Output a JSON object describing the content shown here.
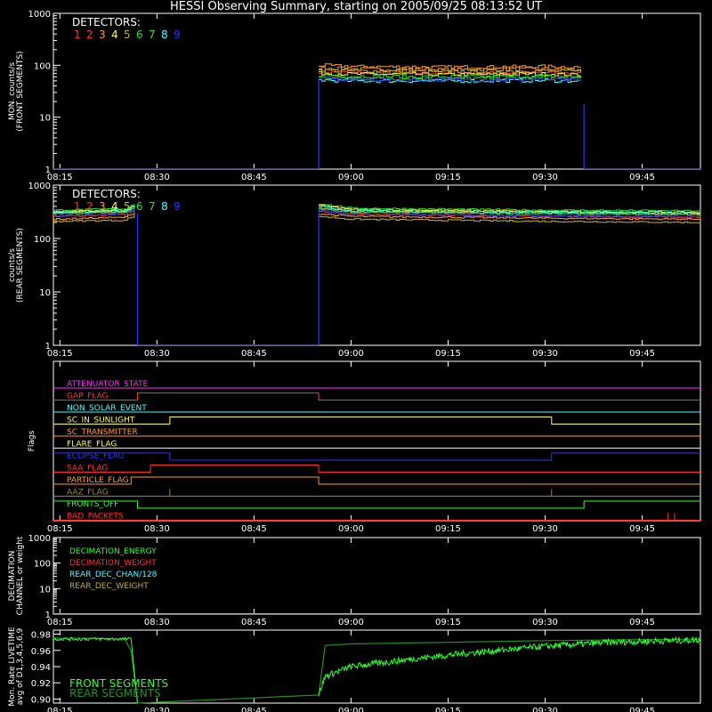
{
  "title": "HESSI Observing Summary, starting on 2005/09/25 08:13:52 UT",
  "time_axis": {
    "start": "08:14",
    "end": "09:54",
    "ticks": [
      "08:15",
      "08:30",
      "08:45",
      "09:00",
      "09:15",
      "09:30",
      "09:45"
    ]
  },
  "colors": {
    "white": "#ffffff",
    "red": "#ff3030",
    "orange": "#ff9a2a",
    "yellow": "#ffff40",
    "green": "#30e030",
    "cyan": "#40ffff",
    "blue": "#3030ff",
    "magenta": "#ff30ff",
    "olive": "#c0b030",
    "lime": "#30ff30",
    "brown": "#a08820"
  },
  "panels": {
    "front": {
      "ylabel": [
        "MON. counts/s",
        "(FRONT SEGMENTS)"
      ],
      "yticks": [
        "1",
        "10",
        "100",
        "1000"
      ],
      "legend_title": "DETECTORS:",
      "detectors": [
        "1",
        "2",
        "3",
        "4",
        "5",
        "6",
        "7",
        "8",
        "9"
      ]
    },
    "rear": {
      "ylabel": [
        "counts/s",
        "(REAR SEGMENTS)"
      ],
      "yticks": [
        "1",
        "10",
        "100",
        "1000"
      ],
      "legend_title": "DETECTORS:",
      "detectors": [
        "1",
        "2",
        "3",
        "4",
        "5",
        "6",
        "7",
        "8",
        "9"
      ]
    },
    "flags": {
      "ylabel": [
        "Flags"
      ],
      "labels": [
        "ATTENUATOR_STATE",
        "GAP_FLAG",
        "NON_SOLAR_EVENT",
        "SC_IN_SUNLIGHT",
        "SC_TRANSMITTER",
        "FLARE_FLAG",
        "ECLIPSE_FLAG",
        "SAA_FLAG",
        "PARTICLE_FLAG",
        "AAZ_FLAG",
        "FRONTS_OFF",
        "BAD_PACKETS"
      ]
    },
    "decimation": {
      "ylabel": [
        "DECIMATION",
        "CHANNEL or weight"
      ],
      "yticks": [
        "1",
        "10",
        "100",
        "1000"
      ],
      "labels": [
        "DECIMATION_ENERGY",
        "DECIMATION_WEIGHT",
        "REAR_DEC_CHAN/128",
        "REAR_DEC_WEIGHT"
      ]
    },
    "livetime": {
      "ylabel": [
        "Mon. Rate LIVETIME",
        "avg of D1,3,4,5,6,9"
      ],
      "yticks": [
        "0.90",
        "0.92",
        "0.94",
        "0.96",
        "0.98"
      ],
      "labels": [
        "FRONT SEGMENTS",
        "REAR SEGMENTS"
      ]
    }
  },
  "chart_data": [
    {
      "type": "line",
      "title": "HESSI Observing Summary, starting on 2005/09/25 08:13:52 UT",
      "ylabel": "MON. counts/s (FRONT SEGMENTS)",
      "yscale": "log",
      "ylim": [
        1,
        1000
      ],
      "gaps": [
        [
          "08:14",
          "08:55"
        ],
        [
          "09:36",
          "09:54"
        ]
      ],
      "series": [
        {
          "name": "1",
          "color": "#ff3030",
          "x": [
            "08:55",
            "09:00",
            "09:15",
            "09:30",
            "09:35"
          ],
          "y": [
            75,
            72,
            70,
            72,
            70
          ]
        },
        {
          "name": "2",
          "color": "#ff9a2a",
          "x": [
            "08:55",
            "09:00",
            "09:15",
            "09:30",
            "09:35"
          ],
          "y": [
            90,
            85,
            82,
            85,
            80
          ]
        },
        {
          "name": "3",
          "color": "#ff9a2a",
          "x": [
            "08:55",
            "09:00",
            "09:15",
            "09:30",
            "09:35"
          ],
          "y": [
            100,
            95,
            92,
            95,
            92
          ]
        },
        {
          "name": "4",
          "color": "#ffff40",
          "x": [
            "08:55",
            "09:00",
            "09:15",
            "09:30",
            "09:35"
          ],
          "y": [
            70,
            68,
            66,
            68,
            66
          ]
        },
        {
          "name": "5",
          "color": "#c0b030",
          "x": [
            "08:55",
            "09:00",
            "09:15",
            "09:30",
            "09:35"
          ],
          "y": [
            80,
            78,
            76,
            78,
            76
          ]
        },
        {
          "name": "6",
          "color": "#30e030",
          "x": [
            "08:55",
            "09:00",
            "09:15",
            "09:30",
            "09:35"
          ],
          "y": [
            65,
            62,
            60,
            62,
            60
          ]
        },
        {
          "name": "7",
          "color": "#30e030",
          "x": [
            "08:55",
            "09:00",
            "09:15",
            "09:30",
            "09:35"
          ],
          "y": [
            58,
            56,
            55,
            57,
            55
          ]
        },
        {
          "name": "8",
          "color": "#40ffff",
          "x": [
            "08:55",
            "09:00",
            "09:15",
            "09:30",
            "09:35"
          ],
          "y": [
            52,
            50,
            50,
            51,
            50
          ]
        },
        {
          "name": "9",
          "color": "#3030ff",
          "x": [
            "08:55",
            "09:00",
            "09:15",
            "09:30",
            "09:35"
          ],
          "y": [
            55,
            53,
            52,
            54,
            52
          ]
        }
      ]
    },
    {
      "type": "line",
      "ylabel": "counts/s (REAR SEGMENTS)",
      "yscale": "log",
      "ylim": [
        1,
        1000
      ],
      "gaps": [
        [
          "08:27",
          "08:55"
        ]
      ],
      "series": [
        {
          "name": "1",
          "color": "#ff3030",
          "x": [
            "08:14",
            "08:25",
            "08:27",
            "08:55",
            "09:00",
            "09:30",
            "09:54"
          ],
          "y": [
            260,
            280,
            380,
            330,
            290,
            260,
            250
          ]
        },
        {
          "name": "2",
          "color": "#ff9a2a",
          "x": [
            "08:14",
            "08:25",
            "08:27",
            "08:55",
            "09:00",
            "09:30",
            "09:54"
          ],
          "y": [
            300,
            320,
            420,
            380,
            320,
            300,
            290
          ]
        },
        {
          "name": "3",
          "color": "#ff9a2a",
          "x": [
            "08:14",
            "08:25",
            "08:27",
            "08:55",
            "09:00",
            "09:30",
            "09:54"
          ],
          "y": [
            230,
            250,
            340,
            290,
            260,
            240,
            230
          ]
        },
        {
          "name": "4",
          "color": "#ffff40",
          "x": [
            "08:14",
            "08:25",
            "08:27",
            "08:55",
            "09:00",
            "09:30",
            "09:54"
          ],
          "y": [
            320,
            340,
            460,
            420,
            350,
            320,
            310
          ]
        },
        {
          "name": "5",
          "color": "#c0b030",
          "x": [
            "08:14",
            "08:25",
            "08:27",
            "08:55",
            "09:00",
            "09:30",
            "09:54"
          ],
          "y": [
            210,
            220,
            300,
            260,
            230,
            210,
            200
          ]
        },
        {
          "name": "6",
          "color": "#30e030",
          "x": [
            "08:14",
            "08:25",
            "08:27",
            "08:55",
            "09:00",
            "09:30",
            "09:54"
          ],
          "y": [
            340,
            360,
            480,
            450,
            370,
            340,
            330
          ]
        },
        {
          "name": "7",
          "color": "#30e030",
          "x": [
            "08:14",
            "08:25",
            "08:27",
            "08:55",
            "09:00",
            "09:30",
            "09:54"
          ],
          "y": [
            290,
            310,
            400,
            360,
            310,
            290,
            280
          ]
        },
        {
          "name": "8",
          "color": "#40ffff",
          "x": [
            "08:14",
            "08:25",
            "08:27",
            "08:55",
            "09:00",
            "09:30",
            "09:54"
          ],
          "y": [
            310,
            330,
            440,
            400,
            330,
            310,
            300
          ]
        },
        {
          "name": "9",
          "color": "#3030ff",
          "x": [
            "08:14",
            "08:25",
            "08:27",
            "08:55",
            "09:00",
            "09:30",
            "09:54"
          ],
          "y": [
            270,
            290,
            390,
            340,
            280,
            270,
            260
          ]
        }
      ]
    },
    {
      "type": "line",
      "ylabel": "Flags",
      "series": [
        {
          "name": "ATTENUATOR_STATE",
          "color": "#ff30ff",
          "segments": [
            [
              "08:14",
              "09:54",
              0
            ]
          ]
        },
        {
          "name": "GAP_FLAG",
          "color": "#ff3030",
          "segments": [
            [
              "08:14",
              "08:27",
              0
            ],
            [
              "08:27",
              "08:55",
              1
            ],
            [
              "08:55",
              "09:54",
              0
            ]
          ]
        },
        {
          "name": "NON_SOLAR_EVENT",
          "color": "#40ffff",
          "segments": [
            [
              "08:14",
              "09:54",
              0
            ]
          ]
        },
        {
          "name": "SC_IN_SUNLIGHT",
          "color": "#ffff40",
          "segments": [
            [
              "08:14",
              "08:32",
              0
            ],
            [
              "08:32",
              "09:31",
              1
            ],
            [
              "09:31",
              "09:54",
              0
            ]
          ]
        },
        {
          "name": "SC_TRANSMITTER",
          "color": "#ff9a2a",
          "segments": [
            [
              "08:14",
              "09:54",
              0
            ]
          ]
        },
        {
          "name": "FLARE_FLAG",
          "color": "#ffff40",
          "segments": [
            [
              "08:14",
              "09:54",
              0
            ]
          ]
        },
        {
          "name": "ECLIPSE_FLAG",
          "color": "#3030ff",
          "segments": [
            [
              "08:14",
              "08:32",
              1
            ],
            [
              "08:32",
              "09:31",
              0
            ],
            [
              "09:31",
              "09:54",
              1
            ]
          ]
        },
        {
          "name": "SAA_FLAG",
          "color": "#ff3030",
          "segments": [
            [
              "08:14",
              "08:29",
              0
            ],
            [
              "08:29",
              "08:55",
              1
            ],
            [
              "08:55",
              "09:54",
              0
            ]
          ]
        },
        {
          "name": "PARTICLE_FLAG",
          "color": "#ff9a2a",
          "segments": [
            [
              "08:14",
              "08:26",
              0
            ],
            [
              "08:26",
              "08:55",
              1
            ],
            [
              "08:55",
              "09:54",
              0
            ]
          ]
        },
        {
          "name": "AAZ_FLAG",
          "color": "#a08820",
          "segments": [
            [
              "08:14",
              "09:54",
              0
            ]
          ],
          "spikes": [
            "08:32",
            "09:31"
          ]
        },
        {
          "name": "FRONTS_OFF",
          "color": "#30ff30",
          "segments": [
            [
              "08:14",
              "08:27",
              1
            ],
            [
              "08:27",
              "09:36",
              0
            ],
            [
              "09:36",
              "09:54",
              1
            ]
          ]
        },
        {
          "name": "BAD_PACKETS",
          "color": "#ff3030",
          "segments": [
            [
              "08:14",
              "09:54",
              0
            ]
          ],
          "spikes": [
            "09:49",
            "09:50"
          ]
        }
      ]
    },
    {
      "type": "line",
      "ylabel": "DECIMATION CHANNEL or weight",
      "yscale": "log",
      "ylim": [
        1,
        1000
      ],
      "series": [
        {
          "name": "DECIMATION_ENERGY",
          "color": "#30ff30",
          "x": [
            "08:14",
            "09:54"
          ],
          "y": [
            1,
            1
          ]
        },
        {
          "name": "DECIMATION_WEIGHT",
          "color": "#ff3030",
          "x": [
            "08:14",
            "09:54"
          ],
          "y": [
            1,
            1
          ]
        },
        {
          "name": "REAR_DEC_CHAN/128",
          "color": "#40ffff",
          "x": [
            "08:14",
            "09:54"
          ],
          "y": [
            1,
            1
          ]
        },
        {
          "name": "REAR_DEC_WEIGHT",
          "color": "#c0b030",
          "x": [
            "08:14",
            "09:54"
          ],
          "y": [
            1,
            1
          ]
        }
      ]
    },
    {
      "type": "line",
      "ylabel": "Mon. Rate LIVETIME avg of D1,3,4,5,6,9",
      "ylim": [
        0.895,
        0.985
      ],
      "series": [
        {
          "name": "FRONT SEGMENTS",
          "color": "#30ff30",
          "x": [
            "08:55",
            "08:56",
            "09:00",
            "09:10",
            "09:20",
            "09:30",
            "09:40",
            "09:54"
          ],
          "y": [
            0.905,
            0.928,
            0.94,
            0.95,
            0.958,
            0.965,
            0.97,
            0.973
          ]
        },
        {
          "name": "REAR SEGMENTS",
          "color": "#209020",
          "x": [
            "08:14",
            "08:20",
            "08:25",
            "08:26",
            "08:27",
            "08:55",
            "08:56",
            "09:00",
            "09:15",
            "09:30",
            "09:54"
          ],
          "y": [
            0.975,
            0.975,
            0.974,
            0.96,
            0.895,
            0.905,
            0.966,
            0.968,
            0.97,
            0.972,
            0.974
          ]
        }
      ]
    }
  ]
}
